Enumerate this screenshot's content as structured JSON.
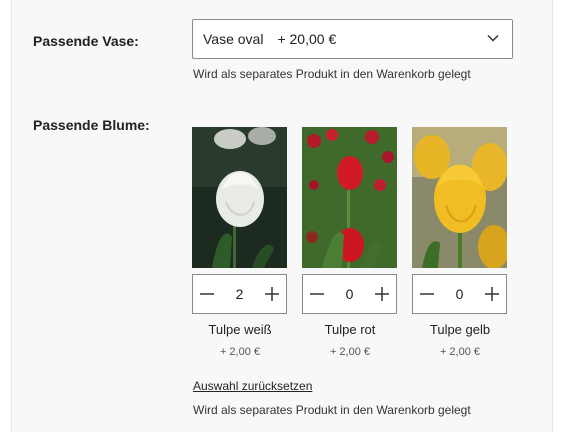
{
  "vase": {
    "label": "Passende Vase:",
    "selected_name": "Vase oval",
    "selected_price": "+ 20,00 €",
    "note": "Wird als separates Produkt in den Warenkorb gelegt"
  },
  "flowers": {
    "label": "Passende Blume:",
    "items": [
      {
        "name": "Tulpe weiß",
        "price": "+ 2,00 €",
        "qty": "2",
        "color": "white"
      },
      {
        "name": "Tulpe rot",
        "price": "+ 2,00 €",
        "qty": "0",
        "color": "red"
      },
      {
        "name": "Tulpe gelb",
        "price": "+ 2,00 €",
        "qty": "0",
        "color": "yellow"
      }
    ],
    "reset_link": "Auswahl zurücksetzen",
    "note": "Wird als separates Produkt in den Warenkorb gelegt"
  },
  "icons": {
    "dropdown": "chevron-down-icon",
    "decrement": "minus-icon",
    "increment": "plus-icon"
  }
}
